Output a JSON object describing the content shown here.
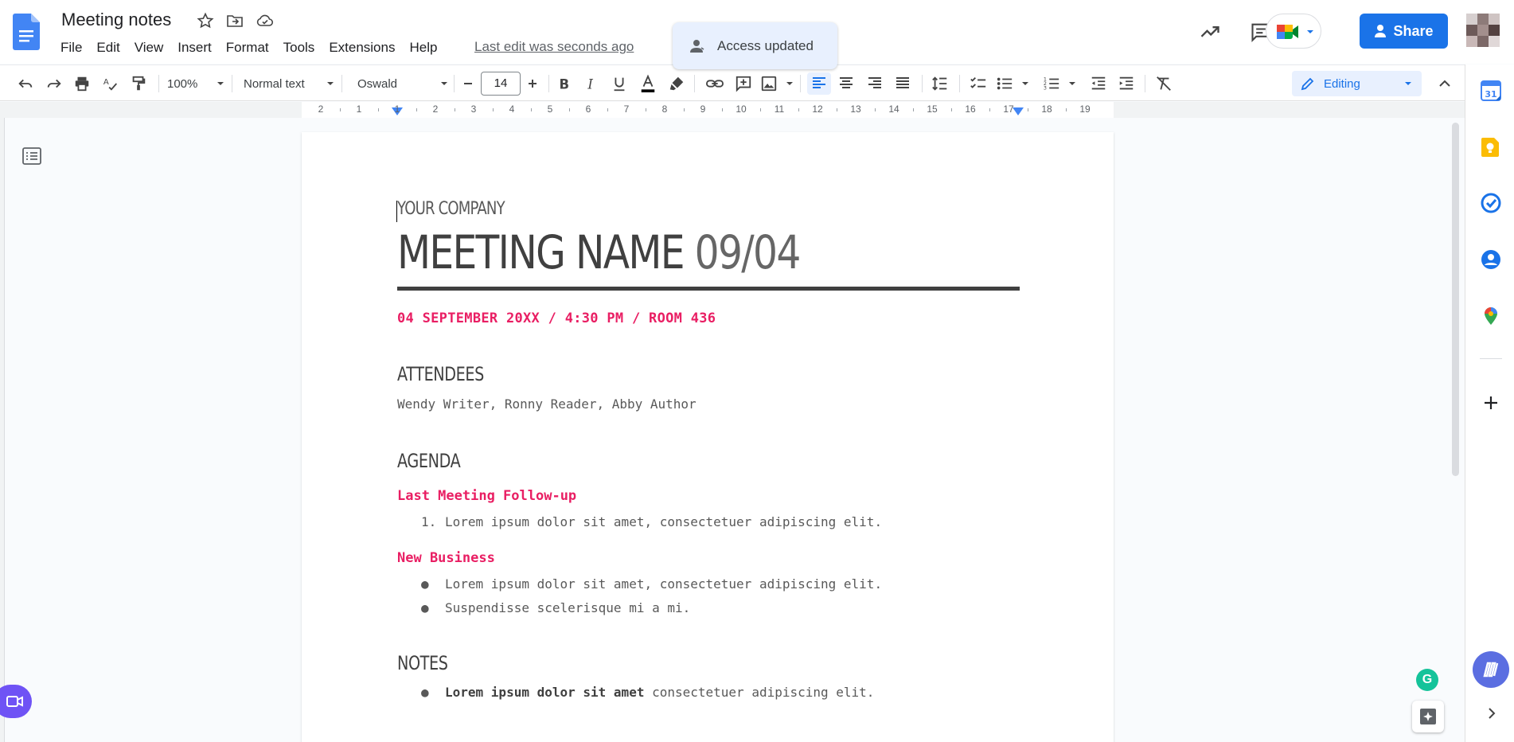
{
  "app": {
    "doc_title": "Meeting notes",
    "last_edit": "Last edit was seconds ago",
    "menus": [
      "File",
      "Edit",
      "View",
      "Insert",
      "Format",
      "Tools",
      "Extensions",
      "Help"
    ],
    "toast": "Access updated",
    "share_label": "Share"
  },
  "toolbar": {
    "zoom": "100%",
    "style": "Normal text",
    "font": "Oswald",
    "font_size": "14",
    "mode": "Editing"
  },
  "ruler": {
    "labels": [
      "2",
      "1",
      "1",
      "2",
      "3",
      "4",
      "5",
      "6",
      "7",
      "8",
      "9",
      "10",
      "11",
      "12",
      "13",
      "14",
      "15",
      "16",
      "17",
      "18",
      "19"
    ]
  },
  "document": {
    "company": "YOUR COMPANY",
    "title_name": "MEETING NAME",
    "title_date": "09/04",
    "meta_line": "04 SEPTEMBER 20XX / 4:30 PM / ROOM 436",
    "attendees_heading": "ATTENDEES",
    "attendees": "Wendy Writer, Ronny Reader, Abby Author",
    "agenda_heading": "AGENDA",
    "followup_heading": "Last Meeting Follow-up",
    "followup_items": [
      "Lorem ipsum dolor sit amet, consectetuer adipiscing elit."
    ],
    "followup_marker": "1.",
    "new_business_heading": "New Business",
    "new_business_items": [
      "Lorem ipsum dolor sit amet, consectetuer adipiscing elit.",
      "Suspendisse scelerisque mi a mi."
    ],
    "notes_heading": "NOTES",
    "notes_first_bold": "Lorem ipsum dolor sit amet",
    "notes_first_rest": " consectetuer adipiscing elit."
  },
  "colors": {
    "accent_pink": "#e91e63",
    "share_blue": "#1a73e8",
    "editing_bg": "#e8f0fe"
  },
  "icons": [
    "docs-logo-icon",
    "star-icon",
    "move-folder-icon",
    "cloud-status-icon",
    "trending-icon",
    "comment-icon",
    "meet-icon",
    "share-person-icon",
    "undo-icon",
    "redo-icon",
    "print-icon",
    "spellcheck-icon",
    "paint-format-icon",
    "bold-icon",
    "italic-icon",
    "underline-icon",
    "text-color-icon",
    "highlight-icon",
    "link-icon",
    "add-comment-icon",
    "image-icon",
    "align-left-icon",
    "align-center-icon",
    "align-right-icon",
    "justify-icon",
    "line-spacing-icon",
    "checklist-icon",
    "bullet-list-icon",
    "numbered-list-icon",
    "indent-decrease-icon",
    "indent-increase-icon",
    "clear-format-icon",
    "pencil-icon",
    "collapse-icon",
    "outline-icon",
    "calendar-icon",
    "keep-icon",
    "tasks-icon",
    "contacts-icon",
    "maps-icon",
    "plus-icon",
    "video-icon",
    "grammarly-icon",
    "explore-icon",
    "chevron-right-icon"
  ]
}
